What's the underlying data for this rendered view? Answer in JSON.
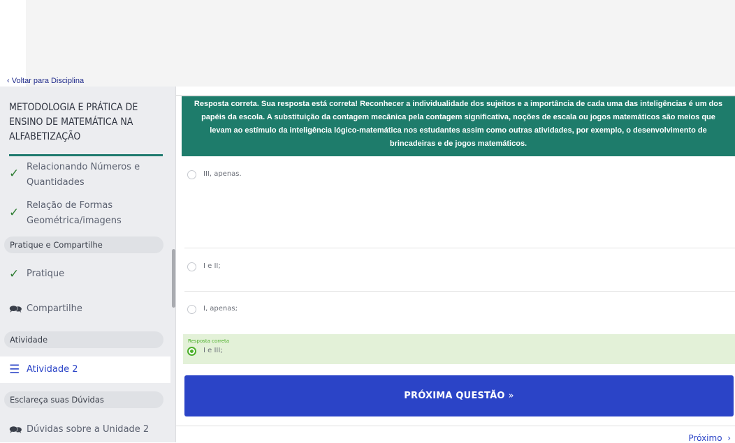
{
  "header": {
    "back_label": "Voltar para Disciplina"
  },
  "sidebar": {
    "course_title": "METODOLOGIA E PRÁTICA DE ENSINO DE MATEMÁTICA NA ALFABETIZAÇÃO",
    "items": [
      {
        "label_line1": "Relacionando Números e",
        "label_line2": "Quantidades",
        "icon": "check-icon"
      },
      {
        "label_line1": "Relação de Formas",
        "label_line2": "Geométrica/imagens",
        "icon": "check-icon"
      }
    ],
    "section_pratique": "Pratique e Compartilhe",
    "pratique_label": "Pratique",
    "compartilhe_label": "Compartilhe",
    "section_atividade": "Atividade",
    "atividade_label": "Atividade 2",
    "section_duvidas": "Esclareça suas Dúvidas",
    "duvidas_label": "Dúvidas sobre a Unidade 2"
  },
  "main": {
    "feedback_text": "Resposta correta. Sua resposta está correta! Reconhecer a individualidade dos sujeitos e a importância de cada uma das inteligências é um dos papéis da escola. A substituição da contagem mecânica pela contagem significativa, noções de escala ou jogos matemáticos são meios que levam ao estímulo da inteligência lógico-matemática nos estudantes assim como outras atividades, por exemplo, o desenvolvimento de brincadeiras e de jogos matemáticos.",
    "options": [
      {
        "label": "III, apenas."
      },
      {
        "label": "I e II;"
      },
      {
        "label": "I, apenas;"
      },
      {
        "label": "I e III;"
      }
    ],
    "correct_label": "Resposta correta",
    "next_button": "PRÓXIMA QUESTÃO",
    "next_link": "Próximo"
  },
  "colors": {
    "accent": "#2b44c7",
    "feedback_bg": "#1e7c6b",
    "correct_bg": "#e3f1d8",
    "correct_green": "#4caf2a"
  }
}
